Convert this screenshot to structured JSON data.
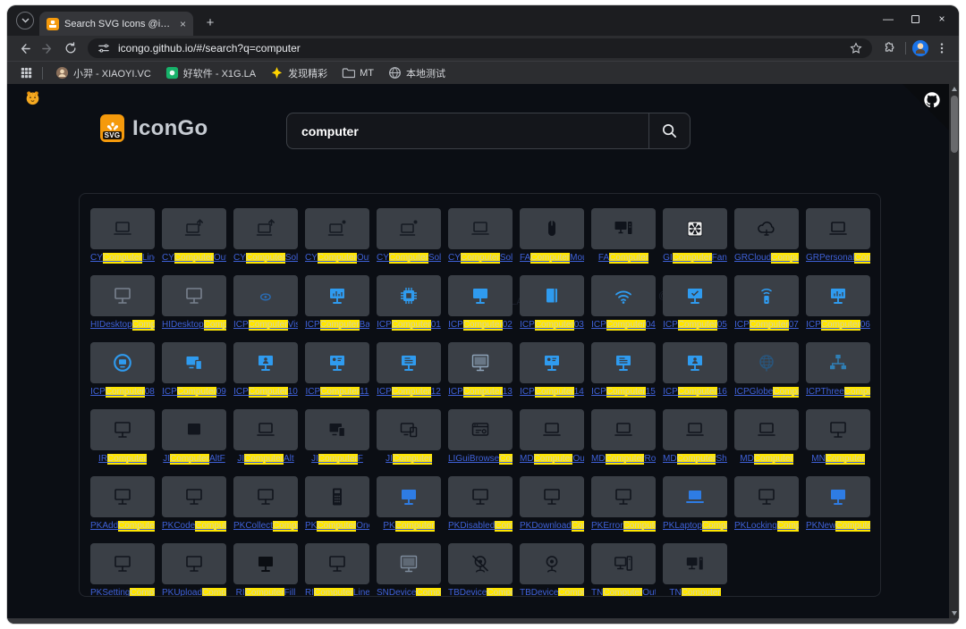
{
  "colors": {
    "highlight_bg": "#ffe600",
    "link_blue": "#3f61d8",
    "icp_blue": "#2f9bef",
    "brand_orange": "#f59a0c",
    "card_bg": "#3a3f46",
    "page_bg": "#0b0e14"
  },
  "browser": {
    "tab_title": "Search SVG Icons @icongo",
    "url": "icongo.github.io/#/search?q=computer",
    "bookmarks": [
      {
        "label": "小羿 - XIAOYI.VC",
        "icon": "avatar-icon"
      },
      {
        "label": "好软件 - X1G.LA",
        "icon": "green-app-icon"
      },
      {
        "label": "发现精彩",
        "icon": "spark-icon"
      },
      {
        "label": "MT",
        "icon": "folder-icon"
      },
      {
        "label": "本地测试",
        "icon": "globe-icon"
      }
    ]
  },
  "page": {
    "brand": "IconGo",
    "logo_text": "SVG",
    "search_value": "computer",
    "watermark_line1": "@下1个好软件",
    "watermark_line2": "/ X1G.LA"
  },
  "icons": [
    {
      "pre": "CY",
      "match": "Computer",
      "post": "Line",
      "glyph": "laptop",
      "color": "#151a22"
    },
    {
      "pre": "CY",
      "match": "Computer",
      "post": "OutlineAlerted",
      "glyph": "laptopArrow",
      "color": "#151a22"
    },
    {
      "pre": "CY",
      "match": "Computer",
      "post": "SolidAlerted",
      "glyph": "laptopArrow",
      "color": "#151a22"
    },
    {
      "pre": "CY",
      "match": "Computer",
      "post": "OutlineBadged",
      "glyph": "laptopDot",
      "color": "#151a22"
    },
    {
      "pre": "CY",
      "match": "Computer",
      "post": "SolidBadged",
      "glyph": "laptopDot",
      "color": "#151a22"
    },
    {
      "pre": "CY",
      "match": "Computer",
      "post": "Solid",
      "glyph": "laptop",
      "color": "#151a22"
    },
    {
      "pre": "FA",
      "match": "Computer",
      "post": "Mouse",
      "glyph": "mouse",
      "color": "#0f131b"
    },
    {
      "pre": "FA",
      "match": "Computer",
      "post": "",
      "glyph": "monitorTower",
      "color": "#0f131b"
    },
    {
      "pre": "GI",
      "match": "Computer",
      "post": "Fan",
      "glyph": "fan",
      "color": "#ececec"
    },
    {
      "pre": "GRCloud",
      "match": "Computer",
      "post": "",
      "glyph": "cloud",
      "color": "#0f131b"
    },
    {
      "pre": "GRPersonal",
      "match": "Computer",
      "post": "",
      "glyph": "laptop",
      "color": "#0f131b"
    },
    {
      "pre": "HIDesktop",
      "match": "Computer",
      "post": "",
      "glyph": "monitor",
      "color": "#79828f"
    },
    {
      "pre": "HIDesktop",
      "match": "Computer",
      "post": "",
      "glyph": "monitor",
      "color": "#79828f"
    },
    {
      "pre": "ICP",
      "match": "Computer",
      "post": "Vision",
      "glyph": "eye",
      "color": "#2a6cb3"
    },
    {
      "pre": "ICP",
      "match": "Computer",
      "post": "Bar",
      "glyph": "monitorBar",
      "color": "#2f9bef"
    },
    {
      "pre": "ICP",
      "match": "Computer",
      "post": "01",
      "glyph": "chip",
      "color": "#2f9bef"
    },
    {
      "pre": "ICP",
      "match": "Computer",
      "post": "02",
      "glyph": "monitorFill",
      "color": "#2f9bef"
    },
    {
      "pre": "ICP",
      "match": "Computer",
      "post": "03",
      "glyph": "bookFill",
      "color": "#2f9bef"
    },
    {
      "pre": "ICP",
      "match": "Computer",
      "post": "04",
      "glyph": "wifi",
      "color": "#2f9bef"
    },
    {
      "pre": "ICP",
      "match": "Computer",
      "post": "05",
      "glyph": "monitorCheck",
      "color": "#2f9bef"
    },
    {
      "pre": "ICP",
      "match": "Computer",
      "post": "07",
      "glyph": "wifiBox",
      "color": "#2f9bef"
    },
    {
      "pre": "ICP",
      "match": "Computer",
      "post": "06",
      "glyph": "monitorBar",
      "color": "#2f9bef"
    },
    {
      "pre": "ICP",
      "match": "Computer",
      "post": "08",
      "glyph": "circMonitor",
      "color": "#2f9bef"
    },
    {
      "pre": "ICP",
      "match": "Computer",
      "post": "09",
      "glyph": "devicesFill",
      "color": "#2f9bef"
    },
    {
      "pre": "ICP",
      "match": "Computer",
      "post": "10",
      "glyph": "monitorPerson",
      "color": "#2f9bef"
    },
    {
      "pre": "ICP",
      "match": "Computer",
      "post": "11",
      "glyph": "monitorDot",
      "color": "#2f9bef"
    },
    {
      "pre": "ICP",
      "match": "Computer",
      "post": "12",
      "glyph": "monitorList",
      "color": "#2f9bef"
    },
    {
      "pre": "ICP",
      "match": "Computer",
      "post": "13",
      "glyph": "monitorFramed",
      "color": "#8fa6bb"
    },
    {
      "pre": "ICP",
      "match": "Computer",
      "post": "14",
      "glyph": "monitorDot",
      "color": "#2f9bef"
    },
    {
      "pre": "ICP",
      "match": "Computer",
      "post": "15",
      "glyph": "monitorList",
      "color": "#2f9bef"
    },
    {
      "pre": "ICP",
      "match": "Computer",
      "post": "16",
      "glyph": "monitorPerson",
      "color": "#2f9bef"
    },
    {
      "pre": "ICPGlobe",
      "match": "Computer",
      "post": "",
      "glyph": "globe",
      "color": "#29567d"
    },
    {
      "pre": "ICPThree",
      "match": "Computer",
      "post": "",
      "glyph": "tree",
      "color": "#2f7fb5"
    },
    {
      "pre": "IR",
      "match": "Computer",
      "post": "",
      "glyph": "monitor",
      "color": "#11151d"
    },
    {
      "pre": "JI",
      "match": "Computer",
      "post": "AltF",
      "glyph": "squareFill",
      "color": "#11151d"
    },
    {
      "pre": "JI",
      "match": "Computer",
      "post": "Alt",
      "glyph": "laptop",
      "color": "#11151d"
    },
    {
      "pre": "JI",
      "match": "Computer",
      "post": "F",
      "glyph": "devicesFill",
      "color": "#11151d"
    },
    {
      "pre": "JI",
      "match": "Computer",
      "post": "",
      "glyph": "devices",
      "color": "#11151d"
    },
    {
      "pre": "LIGuiBrowse",
      "match": "Computer",
      "post": "",
      "glyph": "browser",
      "color": "#11151d"
    },
    {
      "pre": "MD",
      "match": "Computer",
      "post": "Outline",
      "glyph": "laptop",
      "color": "#11151d"
    },
    {
      "pre": "MD",
      "match": "Computer",
      "post": "Round",
      "glyph": "laptop",
      "color": "#11151d"
    },
    {
      "pre": "MD",
      "match": "Computer",
      "post": "Sharp",
      "glyph": "laptop",
      "color": "#11151d"
    },
    {
      "pre": "MD",
      "match": "Computer",
      "post": "",
      "glyph": "laptop",
      "color": "#11151d"
    },
    {
      "pre": "MN",
      "match": "Computer",
      "post": "",
      "glyph": "monitor",
      "color": "#11151d"
    },
    {
      "pre": "PKAdd",
      "match": "Computer",
      "post": "",
      "glyph": "monitor",
      "color": "#11151d"
    },
    {
      "pre": "PKCode",
      "match": "Computer",
      "post": "",
      "glyph": "monitor",
      "color": "#11151d"
    },
    {
      "pre": "PKCollect",
      "match": "Computer",
      "post": "",
      "glyph": "monitor",
      "color": "#11151d"
    },
    {
      "pre": "PK",
      "match": "Computer",
      "post": "One",
      "glyph": "calc",
      "color": "#11151d"
    },
    {
      "pre": "PK",
      "match": "Computer",
      "post": "",
      "glyph": "monitorFill",
      "color": "#2e7ce4"
    },
    {
      "pre": "PKDisabled",
      "match": "Computer",
      "post": "",
      "glyph": "monitor",
      "color": "#11151d"
    },
    {
      "pre": "PKDownload",
      "match": "Computer",
      "post": "",
      "glyph": "monitor",
      "color": "#11151d"
    },
    {
      "pre": "PKError",
      "match": "Computer",
      "post": "",
      "glyph": "monitor",
      "color": "#11151d"
    },
    {
      "pre": "PKLaptop",
      "match": "Computer",
      "post": "",
      "glyph": "laptopFill",
      "color": "#2e7ce4"
    },
    {
      "pre": "PKLocking",
      "match": "Computer",
      "post": "",
      "glyph": "monitor",
      "color": "#11151d"
    },
    {
      "pre": "PKNew",
      "match": "Computer",
      "post": "",
      "glyph": "monitorFill",
      "color": "#2e7ce4"
    },
    {
      "pre": "PKSetting",
      "match": "Computer",
      "post": "",
      "glyph": "monitor",
      "color": "#11151d"
    },
    {
      "pre": "PKUpload",
      "match": "Computer",
      "post": "",
      "glyph": "monitor",
      "color": "#11151d"
    },
    {
      "pre": "RI",
      "match": "Computer",
      "post": "Fill",
      "glyph": "monitorFill",
      "color": "#0b0e13"
    },
    {
      "pre": "RI",
      "match": "Computer",
      "post": "Line",
      "glyph": "monitor",
      "color": "#11151d"
    },
    {
      "pre": "SNDevice",
      "match": "Computer",
      "post": "",
      "glyph": "monitorFramed",
      "color": "#7e8c9d"
    },
    {
      "pre": "TBDevice",
      "match": "Computer",
      "post": "",
      "glyph": "webcamOff",
      "color": "#11151d"
    },
    {
      "pre": "TBDevice",
      "match": "Computer",
      "post": "",
      "glyph": "webcam",
      "color": "#11151d"
    },
    {
      "pre": "TN",
      "match": "Computer",
      "post": "Outline",
      "glyph": "pc",
      "color": "#11151d"
    },
    {
      "pre": "TN",
      "match": "Computer",
      "post": "",
      "glyph": "pcFill",
      "color": "#11151d"
    }
  ]
}
